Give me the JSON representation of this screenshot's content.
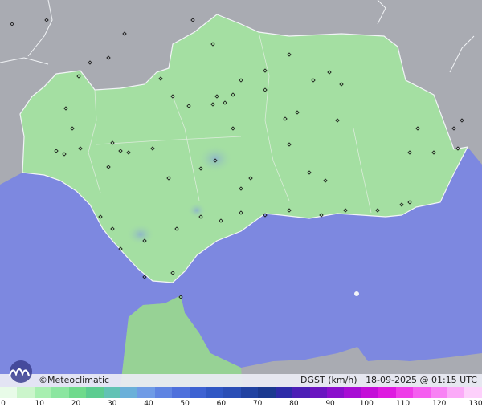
{
  "brand": "©Meteoclimatic",
  "product": "DGST (km/h)",
  "timestamp": "18-09-2025 @ 01:15 UTC",
  "scale": {
    "ticks": [
      "0",
      "10",
      "20",
      "30",
      "40",
      "50",
      "60",
      "70",
      "80",
      "90",
      "100",
      "110",
      "120",
      "130"
    ],
    "colors": [
      "#e8fbe8",
      "#cbf5cb",
      "#a7efb0",
      "#8be6a0",
      "#6fda8c",
      "#5ccc90",
      "#62c2b4",
      "#6bb0d9",
      "#6f9be6",
      "#5f84e2",
      "#4e70dc",
      "#3d62d2",
      "#3057c4",
      "#2a4eb6",
      "#2142a2",
      "#1b3990",
      "#2d2ba8",
      "#4c1fb6",
      "#6a15c0",
      "#8a0fcc",
      "#a70dd4",
      "#c40ed8",
      "#de1ae0",
      "#ee3ce8",
      "#f55ef0",
      "#f882f4",
      "#fbaaf8",
      "#fdd0fb"
    ]
  },
  "colors": {
    "sea": "#7d88e0",
    "land_outside": "#a9abb2",
    "andalusia": "#a4dfa2",
    "morocco": "#97d295",
    "borders": "#f2f4f7"
  }
}
